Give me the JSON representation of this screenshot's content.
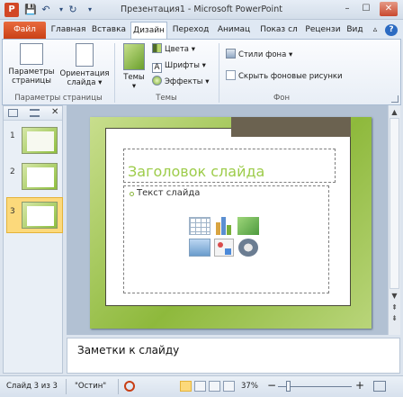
{
  "window": {
    "title": "Презентация1 - Microsoft PowerPoint",
    "app_icon": "P",
    "qat": {
      "save": "💾",
      "undo": "↶",
      "redo": "↻",
      "dropdown": "▾"
    },
    "controls": {
      "minimize": "–",
      "maximize": "☐",
      "close": "✕"
    }
  },
  "tabs": [
    "Файл",
    "Главная",
    "Вставка",
    "Дизайн",
    "Переход",
    "Анимац",
    "Показ сл",
    "Рецензи",
    "Вид"
  ],
  "ribbon_right": {
    "help": "?",
    "collapse": "▵"
  },
  "ribbon": {
    "page_setup": {
      "btn1": [
        "Параметры",
        "страницы"
      ],
      "btn2": [
        "Ориентация",
        "слайда ▾"
      ],
      "group": "Параметры страницы"
    },
    "themes": {
      "themes_btn": "Темы",
      "colors": "Цвета ▾",
      "fonts": "Шрифты ▾",
      "effects": "Эффекты ▾",
      "group": "Темы"
    },
    "background": {
      "styles": "Стили фона ▾",
      "hide": "Скрыть фоновые рисунки",
      "group": "Фон"
    }
  },
  "slides": [
    {
      "num": "1"
    },
    {
      "num": "2"
    },
    {
      "num": "3"
    }
  ],
  "slide": {
    "title_placeholder": "Заголовок слайда",
    "body_placeholder": "Текст слайда"
  },
  "notes_placeholder": "Заметки к слайду",
  "status": {
    "slide_info": "Слайд 3 из 3",
    "theme": "\"Остин\"",
    "zoom": "37%",
    "minus": "−",
    "plus": "+"
  }
}
